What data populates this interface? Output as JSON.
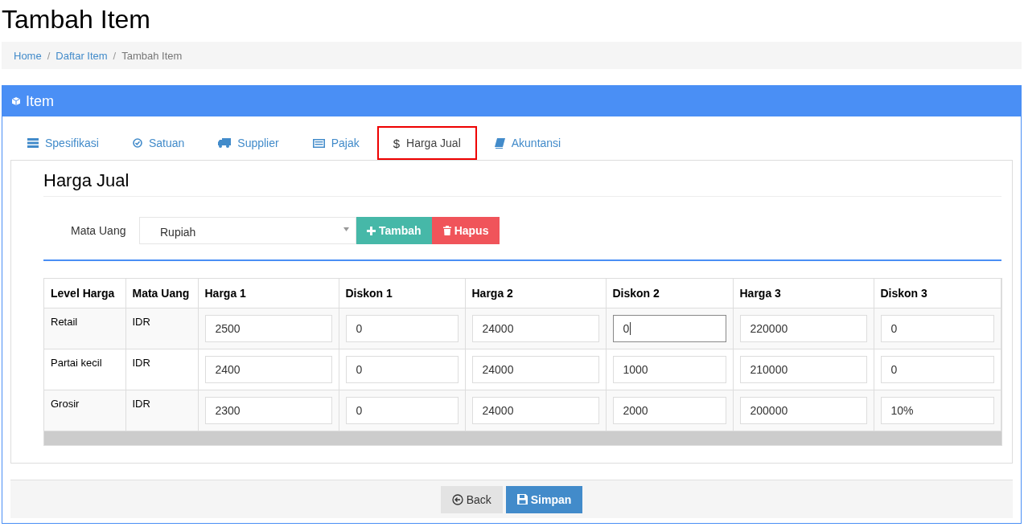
{
  "page_title": "Tambah Item",
  "breadcrumb": [
    {
      "label": "Home",
      "kind": "link"
    },
    {
      "label": "/",
      "kind": "separator"
    },
    {
      "label": "Daftar Item",
      "kind": "link"
    },
    {
      "label": "/",
      "kind": "separator"
    },
    {
      "label": "Tambah Item",
      "kind": "current"
    }
  ],
  "panel": {
    "title": "Item"
  },
  "tabs": [
    {
      "label": "Spesifikasi",
      "selected": false
    },
    {
      "label": "Satuan",
      "selected": false
    },
    {
      "label": "Supplier",
      "selected": false
    },
    {
      "label": "Pajak",
      "selected": false
    },
    {
      "label": "Harga Jual",
      "glyph": "$",
      "selected": true
    },
    {
      "label": "Akuntansi",
      "selected": false
    }
  ],
  "section_title": "Harga Jual",
  "currency": {
    "label": "Mata Uang",
    "value": "Rupiah"
  },
  "buttons": [
    {
      "label": "Tambah",
      "kind": "add"
    },
    {
      "label": "Hapus",
      "kind": "delete"
    }
  ],
  "table": {
    "columns": [
      "Level Harga",
      "Mata Uang",
      "Harga 1",
      "Diskon 1",
      "Harga 2",
      "Diskon 2",
      "Harga 3",
      "Diskon 3"
    ],
    "rows": [
      {
        "cells": [
          {
            "kind": "text",
            "value": "Retail"
          },
          {
            "kind": "text",
            "value": "IDR"
          },
          {
            "kind": "input",
            "value": "2500",
            "focused": false
          },
          {
            "kind": "input",
            "value": "0",
            "focused": false
          },
          {
            "kind": "input",
            "value": "24000",
            "focused": false
          },
          {
            "kind": "input",
            "value": "0",
            "focused": true
          },
          {
            "kind": "input",
            "value": "220000",
            "focused": false
          },
          {
            "kind": "input",
            "value": "0",
            "focused": false
          }
        ]
      },
      {
        "cells": [
          {
            "kind": "text",
            "value": "Partai kecil"
          },
          {
            "kind": "text",
            "value": "IDR"
          },
          {
            "kind": "input",
            "value": "2400",
            "focused": false
          },
          {
            "kind": "input",
            "value": "0",
            "focused": false
          },
          {
            "kind": "input",
            "value": "24000",
            "focused": false
          },
          {
            "kind": "input",
            "value": "1000",
            "focused": false
          },
          {
            "kind": "input",
            "value": "210000",
            "focused": false
          },
          {
            "kind": "input",
            "value": "0",
            "focused": false
          }
        ]
      },
      {
        "cells": [
          {
            "kind": "text",
            "value": "Grosir"
          },
          {
            "kind": "text",
            "value": "IDR"
          },
          {
            "kind": "input",
            "value": "2300",
            "focused": false
          },
          {
            "kind": "input",
            "value": "0",
            "focused": false
          },
          {
            "kind": "input",
            "value": "24000",
            "focused": false
          },
          {
            "kind": "input",
            "value": "2000",
            "focused": false
          },
          {
            "kind": "input",
            "value": "200000",
            "focused": false
          },
          {
            "kind": "input",
            "value": "10%",
            "focused": false
          }
        ]
      }
    ]
  },
  "footer_buttons": [
    {
      "label": "Back",
      "kind": "back"
    },
    {
      "label": "Simpan",
      "kind": "save"
    }
  ]
}
